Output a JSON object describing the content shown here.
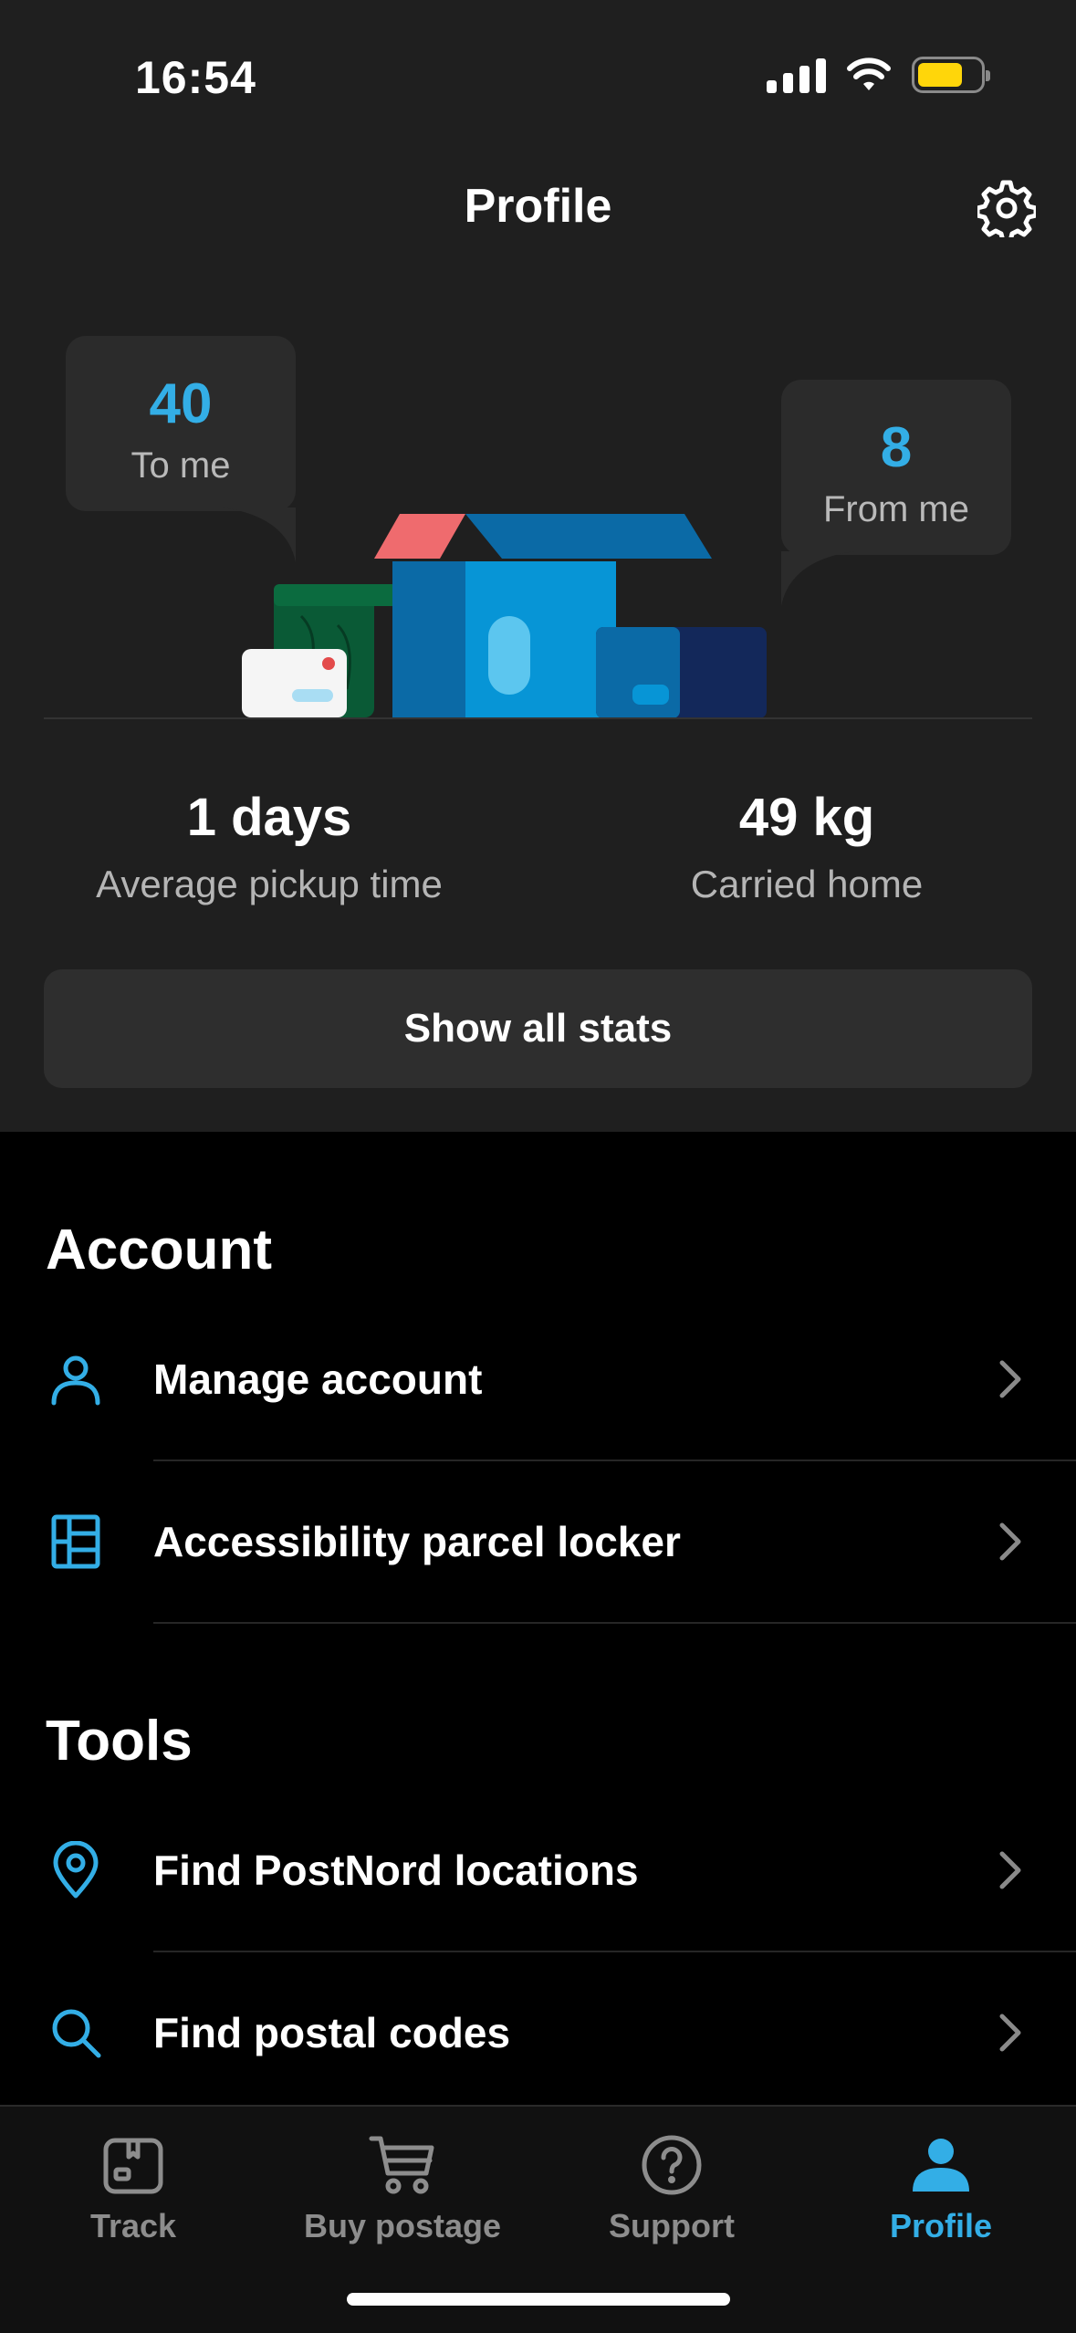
{
  "status_bar": {
    "time": "16:54"
  },
  "header": {
    "title": "Profile"
  },
  "stats": {
    "to_me": {
      "value": "40",
      "label": "To me"
    },
    "from_me": {
      "value": "8",
      "label": "From me"
    }
  },
  "summary": {
    "pickup": {
      "value": "1 days",
      "label": "Average pickup time"
    },
    "carried": {
      "value": "49 kg",
      "label": "Carried home"
    }
  },
  "show_all_stats": "Show all stats",
  "account": {
    "title": "Account",
    "items": [
      {
        "label": "Manage account",
        "icon": "person-icon"
      },
      {
        "label": "Accessibility parcel locker",
        "icon": "parcel-locker-icon"
      }
    ]
  },
  "tools": {
    "title": "Tools",
    "items": [
      {
        "label": "Find PostNord locations",
        "icon": "location-pin-icon"
      },
      {
        "label": "Find postal codes",
        "icon": "search-icon"
      }
    ]
  },
  "tabbar": {
    "items": [
      {
        "label": "Track",
        "icon": "parcel-icon",
        "active": false
      },
      {
        "label": "Buy postage",
        "icon": "cart-icon",
        "active": false
      },
      {
        "label": "Support",
        "icon": "question-icon",
        "active": false
      },
      {
        "label": "Profile",
        "icon": "person-filled-icon",
        "active": true
      }
    ]
  },
  "colors": {
    "accent": "#33aee6",
    "panel": "#1f1f1f",
    "background": "#000000",
    "battery": "#ffd60a"
  }
}
